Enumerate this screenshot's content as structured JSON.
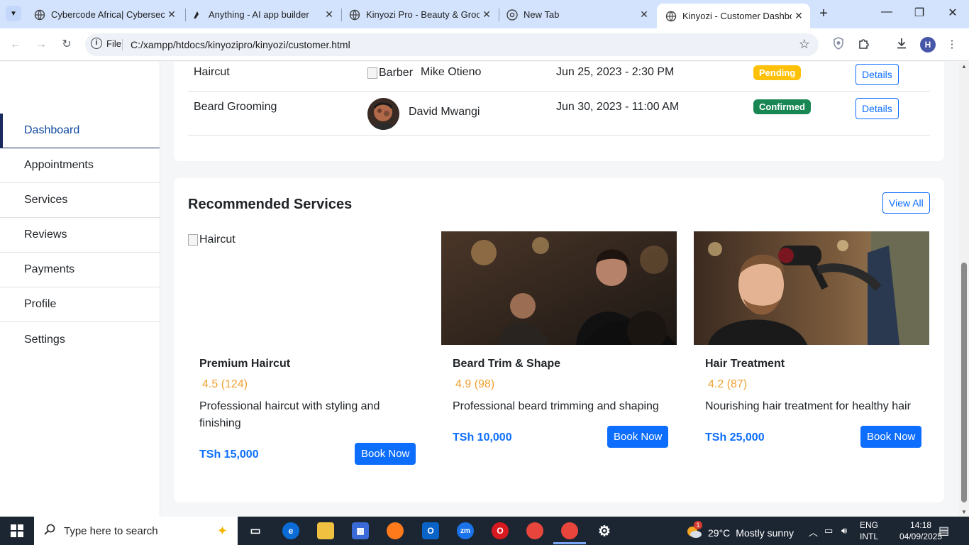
{
  "browser": {
    "tabs": [
      {
        "title": "Cybercode Africa| Cybersecu",
        "icon": "globe-icon"
      },
      {
        "title": "Anything - AI app builder",
        "icon": "anything-logo-icon"
      },
      {
        "title": "Kinyozi Pro - Beauty & Groo",
        "icon": "globe-icon"
      },
      {
        "title": "New Tab",
        "icon": "chrome-icon"
      },
      {
        "title": "Kinyozi - Customer Dashboa",
        "icon": "globe-icon"
      }
    ],
    "address_label": "File",
    "url": "C:/xampp/htdocs/kinyozipro/kinyozi/customer.html",
    "profile_initial": "H"
  },
  "sidebar": {
    "items": [
      {
        "label": "Dashboard",
        "active": true
      },
      {
        "label": "Appointments"
      },
      {
        "label": "Services"
      },
      {
        "label": "Reviews"
      },
      {
        "label": "Payments"
      },
      {
        "label": "Profile"
      },
      {
        "label": "Settings"
      }
    ]
  },
  "appointments": [
    {
      "service": "Haircut",
      "barber_img_alt": "Barber",
      "barber": "Mike Otieno",
      "datetime": "Jun 25, 2023 - 2:30 PM",
      "status": "Pending",
      "action": "Details"
    },
    {
      "service": "Beard Grooming",
      "barber": "David Mwangi",
      "datetime": "Jun 30, 2023 - 11:00 AM",
      "status": "Confirmed",
      "action": "Details"
    }
  ],
  "recommended": {
    "title": "Recommended Services",
    "view_all": "View All",
    "services": [
      {
        "img_alt": "Haircut",
        "name": "Premium Haircut",
        "rating": "4.5 (124)",
        "description": "Professional haircut with styling and finishing",
        "price": "TSh 15,000",
        "cta": "Book Now"
      },
      {
        "name": "Beard Trim & Shape",
        "rating": "4.9 (98)",
        "description": "Professional beard trimming and shaping",
        "price": "TSh 10,000",
        "cta": "Book Now"
      },
      {
        "name": "Hair Treatment",
        "rating": "4.2 (87)",
        "description": "Nourishing hair treatment for healthy hair",
        "price": "TSh 25,000",
        "cta": "Book Now"
      }
    ]
  },
  "taskbar": {
    "search_placeholder": "Type here to search",
    "weather_temp": "29°C",
    "weather_text": "Mostly sunny",
    "weather_badge": "1",
    "lang_line1": "ENG",
    "lang_line2": "INTL",
    "time": "14:18",
    "date": "04/09/2025"
  },
  "colors": {
    "accent": "#0d6efd",
    "pending": "#ffc107",
    "confirmed": "#198754",
    "rating": "#f0a030"
  }
}
